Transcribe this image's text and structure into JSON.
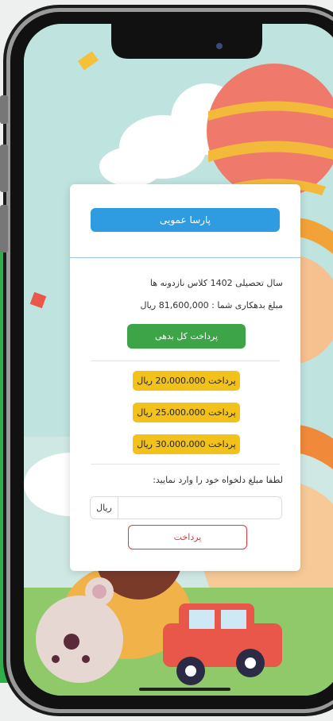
{
  "student": {
    "name": "پارسا عمویی"
  },
  "info": {
    "class_line": "سال تحصیلی 1402 کلاس نازدونه ها",
    "debt_line": "مبلغ بدهکاری شما : 81,600,000 ریال"
  },
  "actions": {
    "pay_all_label": "پرداخت کل بدهی",
    "options": [
      {
        "label": "پرداخت 20،000،000 ریال"
      },
      {
        "label": "پرداخت 25،000،000 ریال"
      },
      {
        "label": "پرداخت 30،000،000 ریال"
      }
    ]
  },
  "custom": {
    "prompt": "لطفا مبلغ دلخواه خود را وارد نمایید:",
    "currency": "ریال",
    "input_value": "",
    "submit_label": "پرداخت"
  },
  "colors": {
    "name_button": "#2f9be0",
    "pay_all": "#3da548",
    "option": "#f2c21a",
    "submit_border": "#e0363f"
  }
}
